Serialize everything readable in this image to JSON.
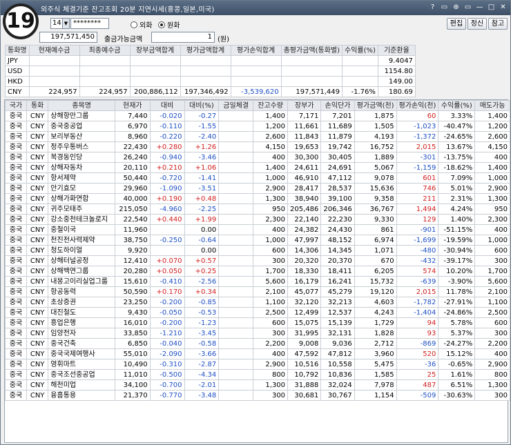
{
  "badge": "19",
  "title": "외주식 체결기준 잔고조회 20분 지연시세(홍콩,일본,미국)",
  "title_icons": [
    "?",
    "▭",
    "⊕",
    "▭",
    "—",
    "□",
    "✕"
  ],
  "account": {
    "suffix": "14",
    "password": "********"
  },
  "currency_mode": {
    "options": [
      "외화",
      "원화"
    ],
    "selected": "원화"
  },
  "buttons": {
    "edit": "편집",
    "refresh": "정신",
    "ref": "참고"
  },
  "deposit_value": "197,571,450",
  "withdraw_label": "출금가능금액",
  "withdraw_value": "1",
  "withdraw_unit": "(원)",
  "fx_table": {
    "headers": [
      "통화명",
      "현재예수금",
      "최종예수금",
      "장부금액합계",
      "평가금액합계",
      "평가손익합계",
      "총평가금액(통화별)",
      "수익률(%)",
      "기준환율"
    ],
    "rows": [
      [
        "JPY",
        "",
        "",
        "",
        "",
        "",
        "",
        "",
        "9.4047"
      ],
      [
        "USD",
        "",
        "",
        "",
        "",
        "",
        "",
        "",
        "1154.80"
      ],
      [
        "HKD",
        "",
        "",
        "",
        "",
        "",
        "",
        "",
        "149.00"
      ],
      [
        "CNY",
        "224,957",
        "224,957",
        "200,886,112",
        "197,346,492",
        "-3,539,620",
        "197,571,449",
        "-1.76%",
        "180.69"
      ]
    ]
  },
  "main_table": {
    "headers": [
      "국가",
      "통화",
      "종목명",
      "현재가",
      "대비",
      "대비(%)",
      "금일체결",
      "잔고수량",
      "장부가",
      "손익단가",
      "평가금액(천)",
      "평가손익(천)",
      "수익률(%)",
      "매도가능"
    ],
    "rows": [
      [
        "중국",
        "CNY",
        "상해항만그룹",
        "7,440",
        "-0.020",
        "-0.27",
        "",
        "1,400",
        "7,171",
        "7,201",
        "1,875",
        "60",
        "3.33%",
        "1,400"
      ],
      [
        "중국",
        "CNY",
        "중국중공업",
        "6,970",
        "-0.110",
        "-1.55",
        "",
        "1,200",
        "11,661",
        "11,689",
        "1,505",
        "-1,023",
        "-40.47%",
        "1,200"
      ],
      [
        "중국",
        "CNY",
        "보리부동산",
        "8,960",
        "-0.220",
        "-2.40",
        "",
        "2,600",
        "11,843",
        "11,879",
        "4,193",
        "-1,372",
        "-24.65%",
        "2,600"
      ],
      [
        "중국",
        "CNY",
        "정주우통버스",
        "22,430",
        "+0.280",
        "+1.26",
        "",
        "4,150",
        "19,653",
        "19,742",
        "16,752",
        "2,015",
        "13.67%",
        "4,150"
      ],
      [
        "중국",
        "CNY",
        "복경동인당",
        "26,240",
        "-0.940",
        "-3.46",
        "",
        "400",
        "30,300",
        "30,405",
        "1,889",
        "-301",
        "-13.75%",
        "400"
      ],
      [
        "중국",
        "CNY",
        "상해자동차",
        "20,110",
        "+0.210",
        "+1.06",
        "",
        "1,400",
        "24,611",
        "24,691",
        "5,067",
        "-1,159",
        "-18.62%",
        "1,400"
      ],
      [
        "중국",
        "CNY",
        "항서제약",
        "50,440",
        "-0.720",
        "-1.41",
        "",
        "1,000",
        "46,910",
        "47,112",
        "9,078",
        "601",
        "7.09%",
        "1,000"
      ],
      [
        "중국",
        "CNY",
        "안기효모",
        "29,960",
        "-1.090",
        "-3.51",
        "",
        "2,900",
        "28,417",
        "28,537",
        "15,636",
        "746",
        "5.01%",
        "2,900"
      ],
      [
        "중국",
        "CNY",
        "상해가화연합",
        "40,000",
        "+0.190",
        "+0.48",
        "",
        "1,300",
        "38,940",
        "39,100",
        "9,358",
        "211",
        "2.31%",
        "1,300"
      ],
      [
        "중국",
        "CNY",
        "귀주모태주",
        "215,050",
        "-4.960",
        "-2.25",
        "",
        "950",
        "205,486",
        "206,346",
        "36,767",
        "1,494",
        "4.24%",
        "950"
      ],
      [
        "중국",
        "CNY",
        "강소중천테크놀로지",
        "22,540",
        "+0.440",
        "+1.99",
        "",
        "2,300",
        "22,140",
        "22,230",
        "9,330",
        "129",
        "1.40%",
        "2,300"
      ],
      [
        "중국",
        "CNY",
        "중철이국",
        "11,960",
        "",
        "0.00",
        "",
        "400",
        "24,382",
        "24,430",
        "861",
        "-901",
        "-51.15%",
        "400"
      ],
      [
        "중국",
        "CNY",
        "천진천사력제약",
        "38,750",
        "-0.250",
        "-0.64",
        "",
        "1,000",
        "47,997",
        "48,152",
        "6,974",
        "-1,699",
        "-19.59%",
        "1,000"
      ],
      [
        "중국",
        "CNY",
        "청도하이얼",
        "9,920",
        "",
        "0.00",
        "",
        "600",
        "14,306",
        "14,345",
        "1,071",
        "-480",
        "-30.94%",
        "600"
      ],
      [
        "중국",
        "CNY",
        "상해터널공정",
        "12,410",
        "+0.070",
        "+0.57",
        "",
        "300",
        "20,320",
        "20,370",
        "670",
        "-432",
        "-39.17%",
        "300"
      ],
      [
        "중국",
        "CNY",
        "상해백연그룹",
        "20,280",
        "+0.050",
        "+0.25",
        "",
        "1,700",
        "18,330",
        "18,411",
        "6,205",
        "574",
        "10.20%",
        "1,700"
      ],
      [
        "중국",
        "CNY",
        "내몽고이리실업그룹",
        "15,610",
        "-0.410",
        "-2.56",
        "",
        "5,600",
        "16,179",
        "16,241",
        "15,732",
        "-639",
        "-3.90%",
        "5,600"
      ],
      [
        "중국",
        "CNY",
        "항공동력",
        "50,590",
        "+0.170",
        "+0.34",
        "",
        "2,100",
        "45,077",
        "45,279",
        "19,120",
        "2,015",
        "11.78%",
        "2,100"
      ],
      [
        "중국",
        "CNY",
        "초상증권",
        "23,250",
        "-0.200",
        "-0.85",
        "",
        "1,100",
        "32,120",
        "32,213",
        "4,603",
        "-1,782",
        "-27.91%",
        "1,100"
      ],
      [
        "중국",
        "CNY",
        "대진철도",
        "9,430",
        "-0.050",
        "-0.53",
        "",
        "2,500",
        "12,499",
        "12,537",
        "4,243",
        "-1,404",
        "-24.86%",
        "2,500"
      ],
      [
        "중국",
        "CNY",
        "흥업은행",
        "16,010",
        "-0.200",
        "-1.23",
        "",
        "600",
        "15,075",
        "15,139",
        "1,729",
        "94",
        "5.78%",
        "600"
      ],
      [
        "중국",
        "CNY",
        "임양전자",
        "33,850",
        "-1.210",
        "-3.45",
        "",
        "300",
        "31,995",
        "32,131",
        "1,828",
        "93",
        "5.37%",
        "300"
      ],
      [
        "중국",
        "CNY",
        "중국건축",
        "6,850",
        "-0.040",
        "-0.58",
        "",
        "2,200",
        "9,008",
        "9,036",
        "2,712",
        "-869",
        "-24.27%",
        "2,200"
      ],
      [
        "중국",
        "CNY",
        "중국국제여행사",
        "55,010",
        "-2.090",
        "-3.66",
        "",
        "400",
        "47,592",
        "47,812",
        "3,960",
        "520",
        "15.12%",
        "400"
      ],
      [
        "중국",
        "CNY",
        "영휘마트",
        "10,490",
        "-0.310",
        "-2.87",
        "",
        "2,900",
        "10,516",
        "10,558",
        "5,475",
        "-36",
        "-0.65%",
        "2,900"
      ],
      [
        "중국",
        "CNY",
        "중국조선중공업",
        "11,010",
        "-0.500",
        "-4.34",
        "",
        "800",
        "10,792",
        "10,836",
        "1,585",
        "25",
        "1.61%",
        "800"
      ],
      [
        "중국",
        "CNY",
        "해천미업",
        "34,100",
        "-0.700",
        "-2.01",
        "",
        "1,300",
        "31,888",
        "32,024",
        "7,978",
        "487",
        "6.51%",
        "1,300"
      ],
      [
        "중국",
        "CNY",
        "융흠통용",
        "21,370",
        "-0.770",
        "-3.48",
        "",
        "300",
        "30,681",
        "30,767",
        "1,154",
        "-509",
        "-30.63%",
        "300"
      ]
    ]
  }
}
